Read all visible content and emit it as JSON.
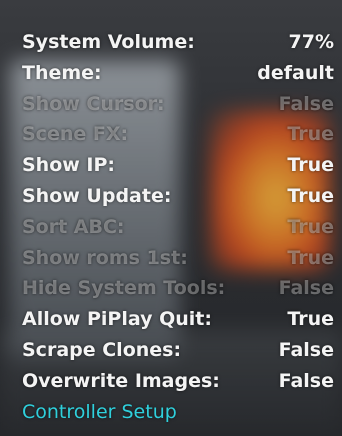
{
  "colors": {
    "enabled_text": "#f4f4f4",
    "disabled_text": "#9a9b9d",
    "link_text": "#2fd0dc"
  },
  "settings": [
    {
      "label": "System Volume:",
      "value": "77%",
      "state": "on"
    },
    {
      "label": "Theme:",
      "value": "default",
      "state": "on"
    },
    {
      "label": "Show Cursor:",
      "value": "False",
      "state": "off"
    },
    {
      "label": "Scene FX:",
      "value": "True",
      "state": "off"
    },
    {
      "label": "Show IP:",
      "value": "True",
      "state": "on"
    },
    {
      "label": "Show Update:",
      "value": "True",
      "state": "on"
    },
    {
      "label": "Sort ABC:",
      "value": "True",
      "state": "off"
    },
    {
      "label": "Show roms 1st:",
      "value": "True",
      "state": "off"
    },
    {
      "label": "Hide System Tools:",
      "value": "False",
      "state": "off"
    },
    {
      "label": "Allow PiPlay Quit:",
      "value": "True",
      "state": "on"
    },
    {
      "label": "Scrape Clones:",
      "value": "False",
      "state": "on"
    },
    {
      "label": "Overwrite Images:",
      "value": "False",
      "state": "on"
    }
  ],
  "controller_setup_label": "Controller Setup"
}
